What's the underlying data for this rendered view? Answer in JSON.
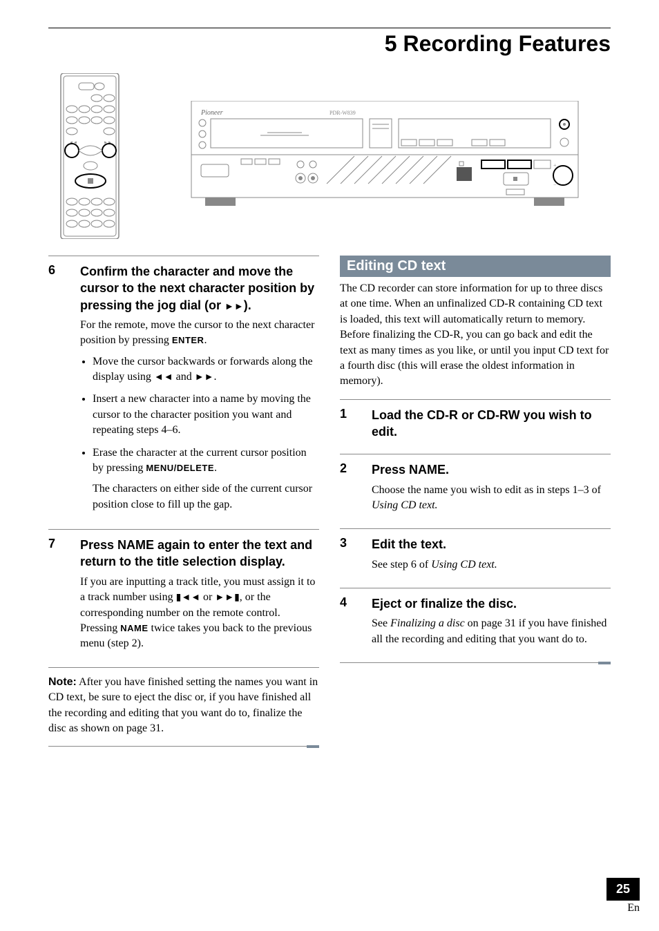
{
  "chapter": "5 Recording Features",
  "left": {
    "step6": {
      "num": "6",
      "head_a": "Confirm the character and move the cursor to the next character position by pressing the jog dial (or ",
      "head_glyph": "¬¬",
      "head_b": ").",
      "text1a": "For the remote, move the cursor to the next character position by pressing ",
      "text1b": "ENTER",
      "text1c": ".",
      "bullet1a": "Move the cursor backwards or forwards along the display using ",
      "bullet1b": "´´",
      "bullet1c": " and ",
      "bullet1d": "¬¬",
      "bullet1e": ".",
      "bullet2": "Insert a new character into a name by moving the cursor to the character position you want and repeating steps 4–6.",
      "bullet3a": "Erase the character at the current cursor position by pressing ",
      "bullet3b": "MENU/DELETE",
      "bullet3c": ".",
      "aftertext": "The characters on either side of the current cursor position close to fill up the gap."
    },
    "step7": {
      "num": "7",
      "head": "Press NAME again to enter the text and return to the title selection display.",
      "text_a": "If you are inputting a track title, you must assign it to a track number using ",
      "text_g1": "Ã´´",
      "text_b": " or ",
      "text_g2": "¬¬Ã",
      "text_c": ", or the corresponding number on the remote control. Pressing ",
      "name": "NAME",
      "text_d": " twice takes you back to the previous menu (step 2)."
    },
    "note": {
      "label": "Note:",
      "text": " After you have finished setting the names you want in CD text, be sure to eject the disc or, if you have finished all the recording and editing that you want do to, finalize the disc as shown on page 31."
    }
  },
  "right": {
    "section_title": "Editing CD text",
    "intro": "The CD recorder can store information for up to three discs at one time. When an unfinalized CD-R containing CD text is loaded, this text will automatically return to memory. Before finalizing the CD-R, you can go back and edit the text as many times as you like, or until you input CD text for a fourth disc (this will erase the oldest information in memory).",
    "s1": {
      "num": "1",
      "head": "Load the CD-R or CD-RW you wish to edit."
    },
    "s2": {
      "num": "2",
      "head": "Press NAME.",
      "text_a": "Choose the name you wish to edit as in steps 1–3 of ",
      "italic": "Using CD text.",
      "text_b": ""
    },
    "s3": {
      "num": "3",
      "head": "Edit the text.",
      "text_a": "See step 6 of ",
      "italic": "Using CD text.",
      "text_b": ""
    },
    "s4": {
      "num": "4",
      "head": "Eject or finalize the disc.",
      "text_a": "See ",
      "italic": "Finalizing a disc",
      "text_b": " on page 31 if you have finished all the recording and editing that you want do to."
    }
  },
  "page": {
    "num": "25",
    "lang": "En"
  },
  "device": {
    "brand": "Pioneer",
    "model": "PDR-W839"
  }
}
